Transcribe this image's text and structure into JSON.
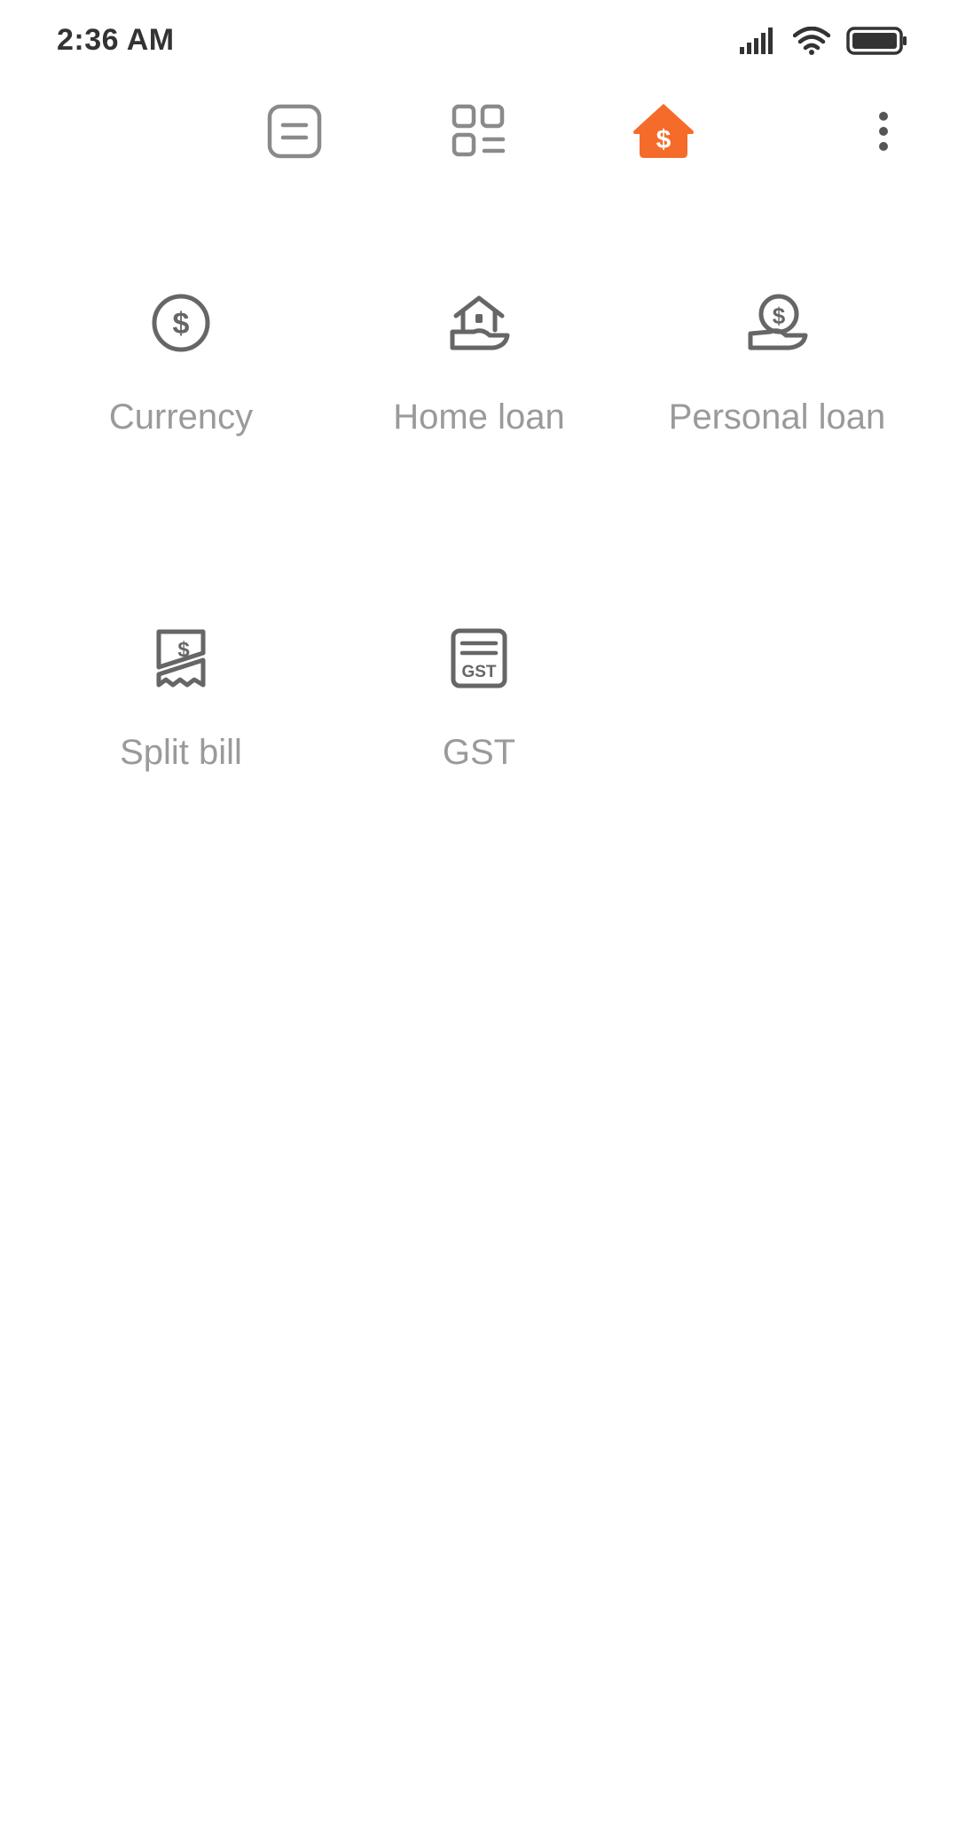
{
  "status_bar": {
    "time": "2:36 AM",
    "icons": [
      "signal-icon",
      "wifi-icon",
      "battery-icon"
    ]
  },
  "top_nav": {
    "items": [
      {
        "icon": "list-icon",
        "active": false
      },
      {
        "icon": "grid-list-icon",
        "active": false
      },
      {
        "icon": "finance-home-icon",
        "active": true
      },
      {
        "icon": "more-vertical-icon",
        "active": false
      }
    ],
    "active_color": "#F56B2A",
    "inactive_color": "#8a8a8a"
  },
  "tools": {
    "items": [
      {
        "label": "Currency",
        "icon": "currency-icon"
      },
      {
        "label": "Home loan",
        "icon": "home-loan-icon"
      },
      {
        "label": "Personal loan",
        "icon": "personal-loan-icon"
      },
      {
        "label": "Split bill",
        "icon": "split-bill-icon"
      },
      {
        "label": "GST",
        "icon": "gst-icon"
      }
    ],
    "icon_color": "#666666",
    "label_color": "#9a9a9a"
  }
}
